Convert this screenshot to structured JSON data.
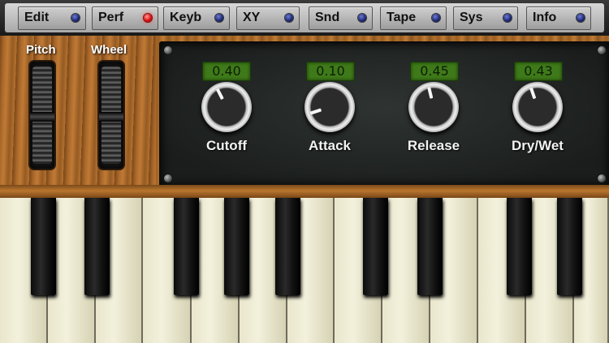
{
  "topbar": {
    "tabs": [
      {
        "label": "Edit",
        "active": false
      },
      {
        "label": "Perf",
        "active": true
      },
      {
        "label": "Keyb",
        "active": false
      },
      {
        "label": "XY",
        "active": false
      },
      {
        "label": "Snd",
        "active": false
      },
      {
        "label": "Tape",
        "active": false
      },
      {
        "label": "Sys",
        "active": false
      },
      {
        "label": "Info",
        "active": false
      }
    ]
  },
  "wheels": {
    "pitch_label": "Pitch",
    "wheel_label": "Wheel"
  },
  "knobs": [
    {
      "label": "Cutoff",
      "value": "0.40",
      "level": 0.4
    },
    {
      "label": "Attack",
      "value": "0.10",
      "level": 0.1
    },
    {
      "label": "Release",
      "value": "0.45",
      "level": 0.45
    },
    {
      "label": "Dry/Wet",
      "value": "0.43",
      "level": 0.43
    }
  ],
  "colors": {
    "led_active": "#e01010",
    "led_inactive": "#1a2470",
    "readout_green": "#3f7a1a"
  }
}
